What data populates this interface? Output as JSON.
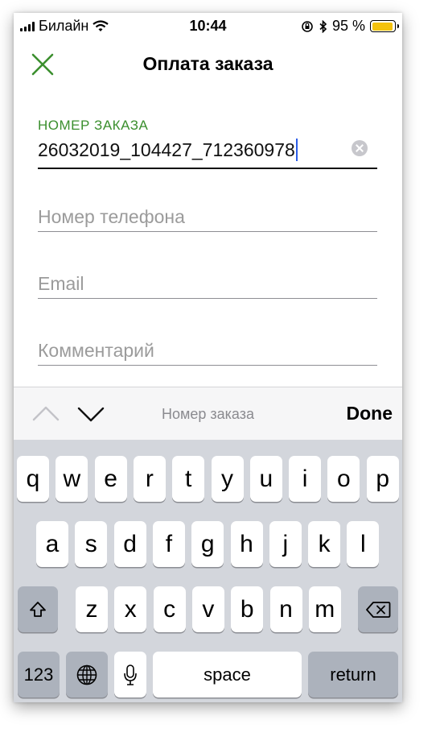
{
  "status_bar": {
    "carrier": "Билайн",
    "time": "10:44",
    "battery_text": "95 %",
    "battery_level": 0.95,
    "icons": [
      "signal-icon",
      "wifi-icon",
      "orientation-lock-icon",
      "bluetooth-icon",
      "battery-icon"
    ]
  },
  "nav": {
    "title": "Оплата заказа",
    "close_icon": "close-icon",
    "accent_color": "#3b8f2e"
  },
  "form": {
    "order_label": "НОМЕР ЗАКАЗА",
    "order_value": "26032019_104427_712360978",
    "phone_placeholder": "Номер телефона",
    "email_placeholder": "Email",
    "comment_placeholder": "Комментарий"
  },
  "toolbar": {
    "current_field": "Номер заказа",
    "done_label": "Done"
  },
  "keyboard": {
    "row1": [
      "q",
      "w",
      "e",
      "r",
      "t",
      "y",
      "u",
      "i",
      "o",
      "p"
    ],
    "row2": [
      "a",
      "s",
      "d",
      "f",
      "g",
      "h",
      "j",
      "k",
      "l"
    ],
    "row3": [
      "z",
      "x",
      "c",
      "v",
      "b",
      "n",
      "m"
    ],
    "numbers_label": "123",
    "space_label": "space",
    "return_label": "return"
  }
}
